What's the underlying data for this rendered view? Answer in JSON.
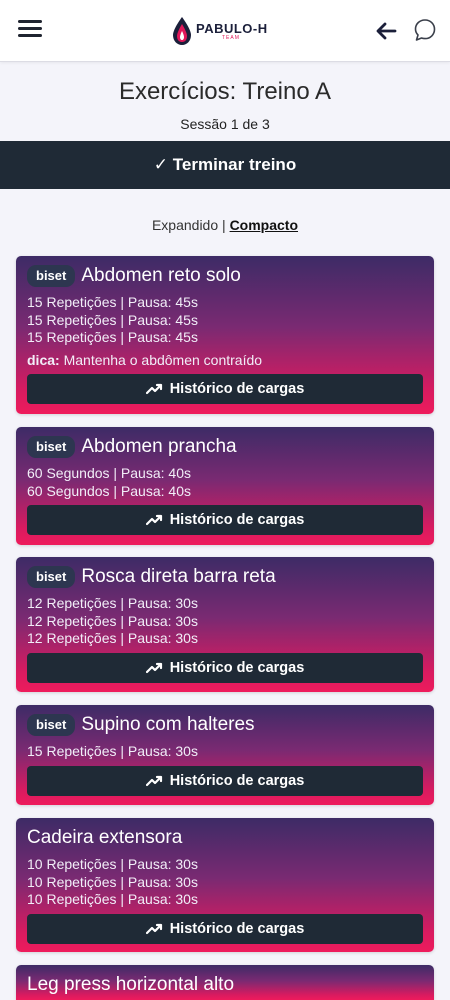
{
  "header": {
    "menu_icon": "hamburger-menu-icon",
    "logo": {
      "name": "PABULO-H",
      "sub": "TEAM"
    },
    "back_icon": "arrow-left-icon",
    "chat_icon": "chat-bubble-icon"
  },
  "page": {
    "title": "Exercícios: Treino A",
    "session": "Sessão 1 de 3",
    "finish_label": "✓ Terminar treino"
  },
  "view_toggle": {
    "expanded": "Expandido",
    "separator": "|",
    "compact": "Compacto"
  },
  "history_label": "Histórico de cargas",
  "tip_label": "dica:",
  "exercises": [
    {
      "badge": "biset",
      "name": "Abdomen reto solo",
      "sets": [
        "15 Repetições | Pausa: 45s",
        "15 Repetições | Pausa: 45s",
        "15 Repetições | Pausa: 45s"
      ],
      "tip": "Mantenha o abdômen contraído"
    },
    {
      "badge": "biset",
      "name": "Abdomen prancha",
      "sets": [
        "60 Segundos | Pausa: 40s",
        "60 Segundos | Pausa: 40s"
      ]
    },
    {
      "badge": "biset",
      "name": "Rosca direta barra reta",
      "sets": [
        "12 Repetições | Pausa: 30s",
        "12 Repetições | Pausa: 30s",
        "12 Repetições | Pausa: 30s"
      ]
    },
    {
      "badge": "biset",
      "name": "Supino com halteres",
      "sets": [
        "15 Repetições | Pausa: 30s"
      ]
    },
    {
      "badge": "",
      "name": "Cadeira extensora",
      "sets": [
        "10 Repetições | Pausa: 30s",
        "10 Repetições | Pausa: 30s",
        "10 Repetições | Pausa: 30s"
      ]
    },
    {
      "badge": "",
      "name": "Leg press horizontal alto",
      "sets": []
    }
  ],
  "colors": {
    "accent": "#ee1b5c",
    "card_top": "#3d2b66",
    "dark_button": "#1f2a36"
  }
}
